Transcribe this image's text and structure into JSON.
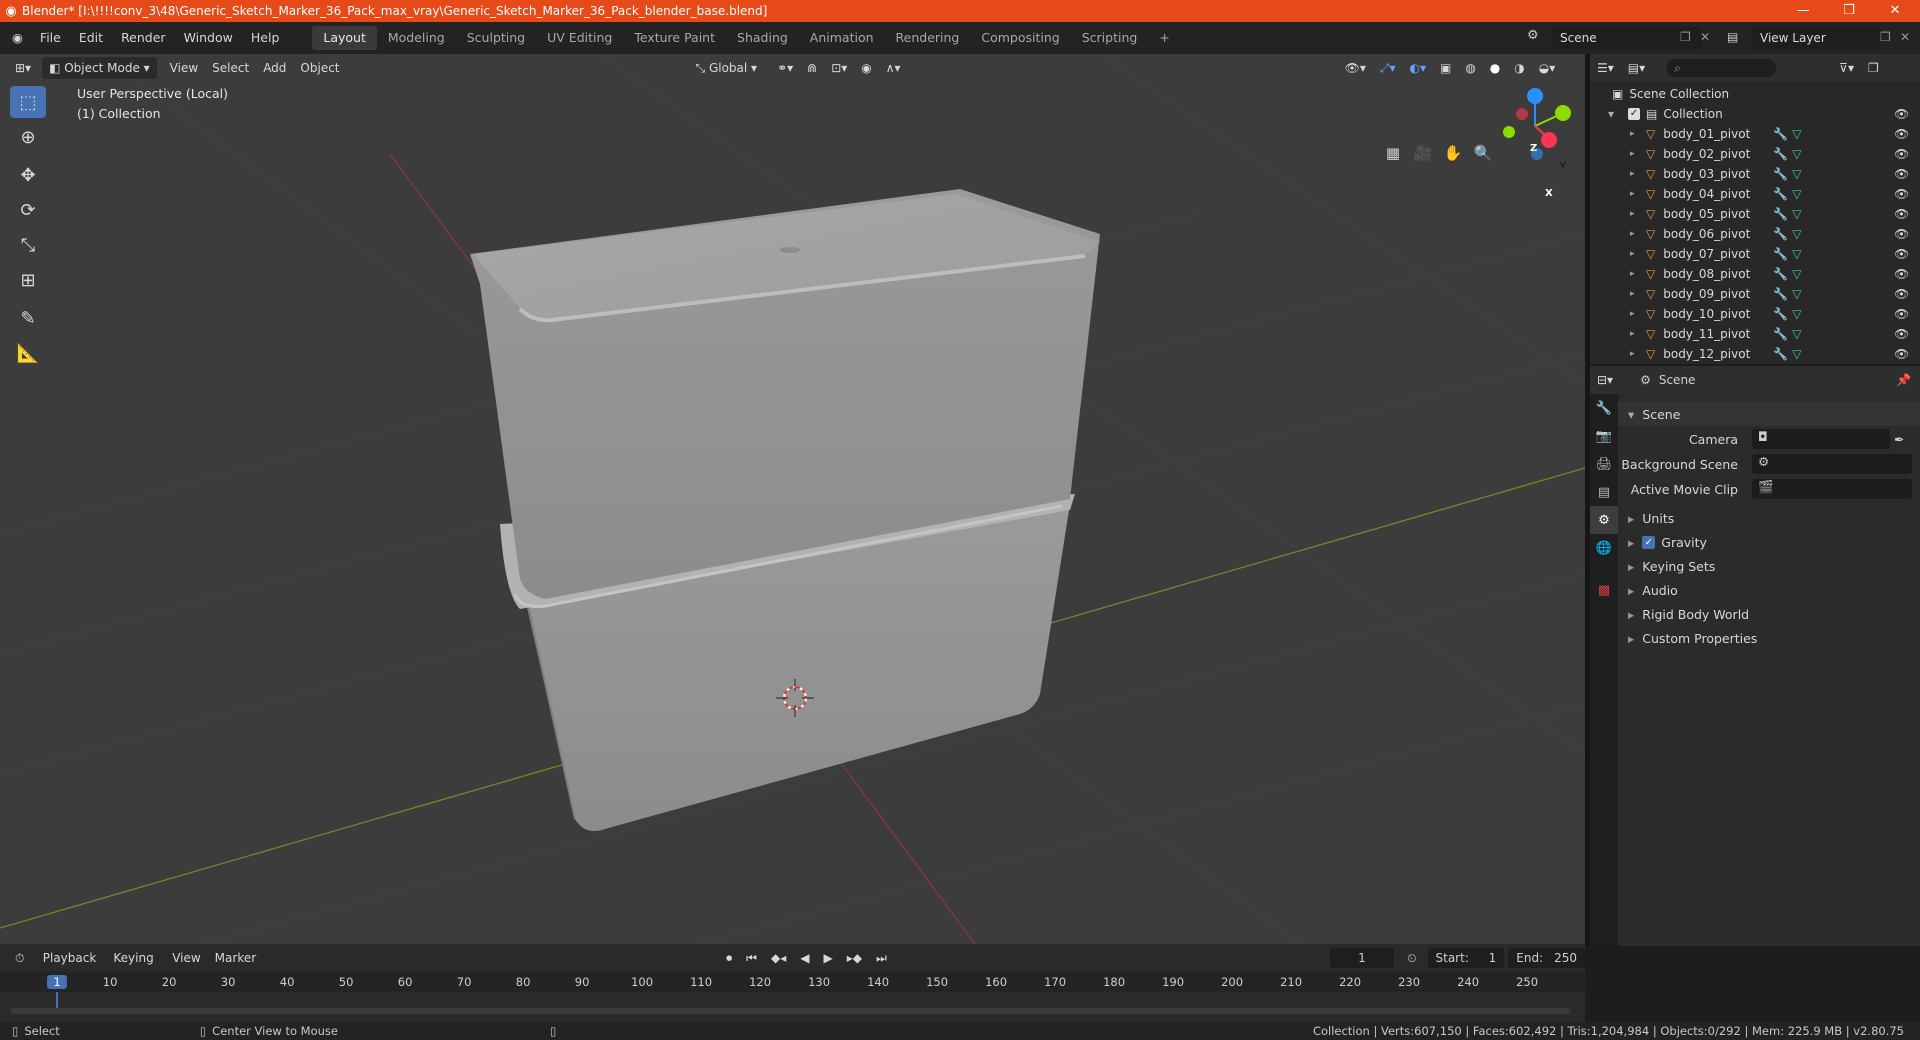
{
  "window": {
    "title": "Blender* [I:\\!!!!conv_3\\48\\Generic_Sketch_Marker_36_Pack_max_vray\\Generic_Sketch_Marker_36_Pack_blender_base.blend]",
    "accent_color": "#e64a19",
    "controls": [
      "—",
      "❐",
      "✕"
    ]
  },
  "menu": {
    "items": [
      "File",
      "Edit",
      "Render",
      "Window",
      "Help"
    ],
    "workspaces": [
      "Layout",
      "Modeling",
      "Sculpting",
      "UV Editing",
      "Texture Paint",
      "Shading",
      "Animation",
      "Rendering",
      "Compositing",
      "Scripting"
    ],
    "active_workspace": "Layout",
    "add_tab": "+",
    "scene_name": "Scene",
    "view_layer": "View Layer"
  },
  "viewport": {
    "mode": "Object Mode",
    "menus": [
      "View",
      "Select",
      "Add",
      "Object"
    ],
    "orientation": "Global",
    "info_line1": "User Perspective (Local)",
    "info_line2": "(1) Collection",
    "gizmo_axes": [
      "Z",
      "Y",
      "X"
    ],
    "axis_colors": {
      "x": "#ff3352",
      "y": "#8bdc00",
      "z": "#2890ff"
    }
  },
  "outliner": {
    "root": "Scene Collection",
    "collection": "Collection",
    "items": [
      "body_01_pivot",
      "body_02_pivot",
      "body_03_pivot",
      "body_04_pivot",
      "body_05_pivot",
      "body_06_pivot",
      "body_07_pivot",
      "body_08_pivot",
      "body_09_pivot",
      "body_10_pivot",
      "body_11_pivot",
      "body_12_pivot"
    ]
  },
  "properties": {
    "context": "Scene",
    "panel": "Scene",
    "fields": [
      {
        "label": "Camera",
        "value": ""
      },
      {
        "label": "Background Scene",
        "value": ""
      },
      {
        "label": "Active Movie Clip",
        "value": ""
      }
    ],
    "subpanels": [
      "Units",
      "Gravity",
      "Keying Sets",
      "Audio",
      "Rigid Body World",
      "Custom Properties"
    ],
    "gravity_checked": true
  },
  "timeline": {
    "menus": [
      "Playback",
      "Keying",
      "View",
      "Marker"
    ],
    "current_frame": "1",
    "start_label": "Start:",
    "start": "1",
    "end_label": "End:",
    "end": "250",
    "ruler": [
      "1",
      "10",
      "20",
      "30",
      "40",
      "50",
      "60",
      "70",
      "80",
      "90",
      "100",
      "110",
      "120",
      "130",
      "140",
      "150",
      "160",
      "170",
      "180",
      "190",
      "200",
      "210",
      "220",
      "230",
      "240",
      "250"
    ]
  },
  "status": {
    "left_action": "Select",
    "middle_action": "Center View to Mouse",
    "stats": "Collection | Verts:607,150 | Faces:602,492 | Tris:1,204,984 | Objects:0/292 | Mem: 225.9 MB | v2.80.75"
  }
}
